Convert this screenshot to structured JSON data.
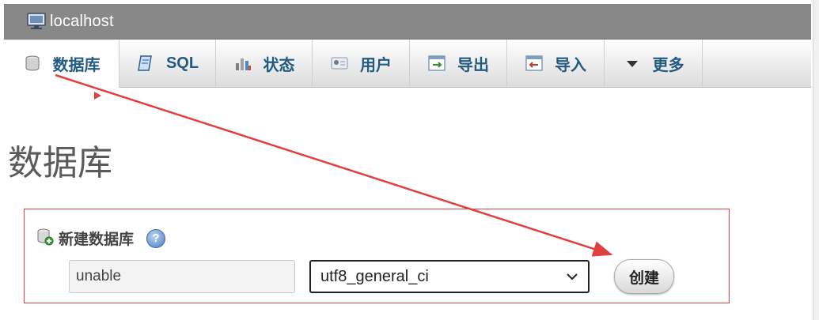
{
  "header": {
    "title": "localhost",
    "icon": "server-icon"
  },
  "tabs": [
    {
      "label": "数据库",
      "icon": "database-icon",
      "active": true
    },
    {
      "label": "SQL",
      "icon": "sql-icon"
    },
    {
      "label": "状态",
      "icon": "status-icon"
    },
    {
      "label": "用户",
      "icon": "users-icon"
    },
    {
      "label": "导出",
      "icon": "export-icon"
    },
    {
      "label": "导入",
      "icon": "import-icon"
    },
    {
      "label": "更多",
      "icon": "chevron-down-icon"
    }
  ],
  "page": {
    "title": "数据库"
  },
  "create_database": {
    "label": "新建数据库",
    "help_symbol": "?",
    "name_value": "unable",
    "collation_value": "utf8_general_ci",
    "create_label": "创建"
  },
  "colors": {
    "tab_text": "#235a81",
    "highlight_border": "#e14040",
    "arrow": "#e14040",
    "titlebar_bg": "#888888"
  }
}
